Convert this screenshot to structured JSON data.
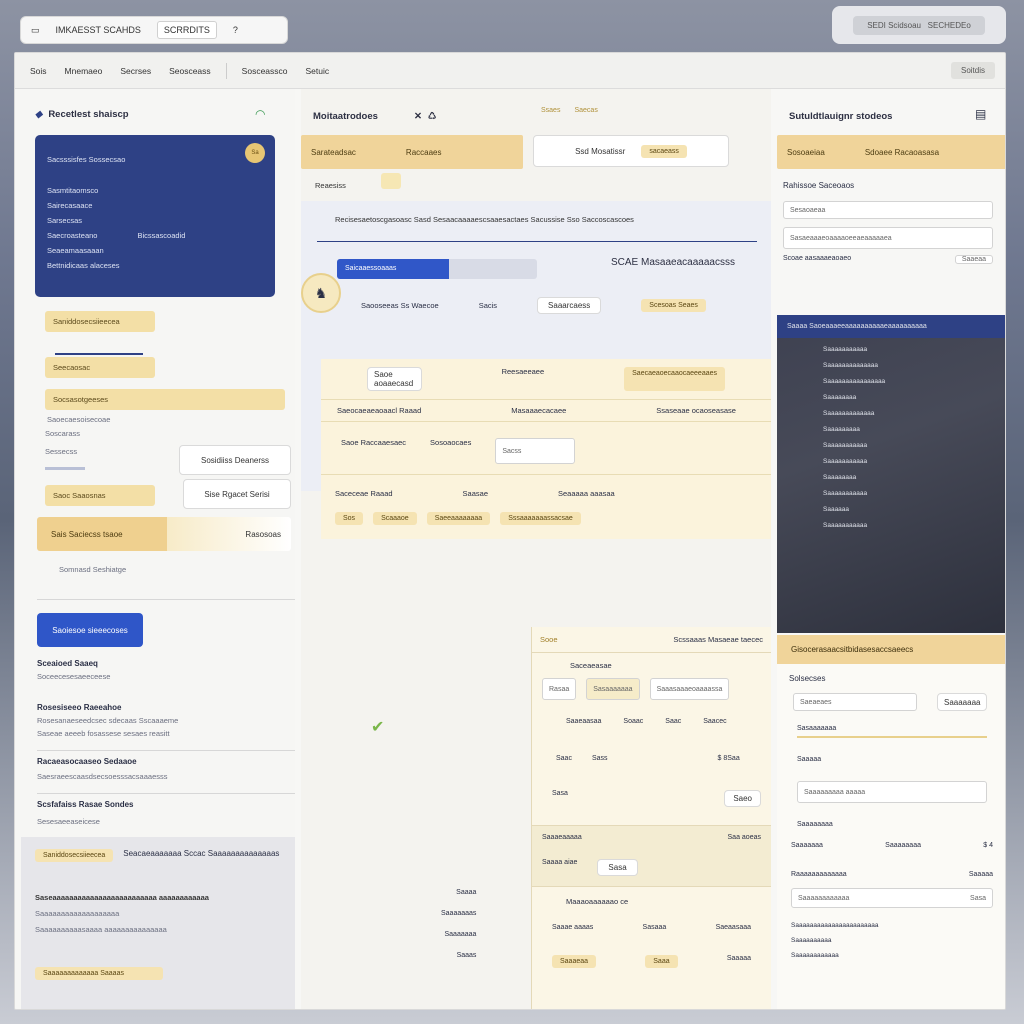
{
  "top_tabs": {
    "tab1": "IMKAESST SCAHDS",
    "tab2": "SCRRDITS",
    "help": "?"
  },
  "top_right": {
    "label": "SEDI Scidsoau",
    "button": "SECHEDEo"
  },
  "menubar": {
    "items": [
      "Sois",
      "Mnemaeo",
      "Secrses",
      "Seosceass",
      "Sosceassco",
      "Setuic"
    ],
    "right_button": "Soitdis"
  },
  "left": {
    "title": "Recetlest shaiscp",
    "card": {
      "header": "Sacsssisfes Sossecsao",
      "rows": [
        "Sasmtitaomsco",
        "Sairecasaace",
        "Sarsecsas",
        "Saecroasteano",
        "Bicssascoadid",
        "Seaeamaasaaan",
        "Bettnidicaas alaceses"
      ],
      "coin": "Sa"
    },
    "gold_rows": [
      "Saniddosecsiieecea",
      "Seecaosac",
      "Socsasotgeeses",
      "Saoc Saaosnas"
    ],
    "labels": [
      "Saoecaesoisecoae",
      "Soscarass",
      "Sessecss"
    ],
    "btn_a": "Sosidiiss Deanerss",
    "btn_b": "Sise Rgacet Serisi",
    "summary_label": "Sais Saciecss tsaoe",
    "summary_value": "Rasosoas",
    "summary_sub": "Somnasd Seshiatge",
    "blue_button": "Saoiesoe sieeecoses",
    "sections": [
      {
        "title": "Sceaioed Saaeq",
        "lines": [
          "Soceecesesaeeceese"
        ]
      },
      {
        "title": "Rosesiseeo Raeeahoe",
        "lines": [
          "Rosesanaeseedcsec sdecaas Sscaaaeme",
          "Saseae aeeeb fosassese sesaes reasitt"
        ]
      },
      {
        "title": "Racaeasocaaseo Sedaaoe",
        "lines": [
          "Saesraeescaasdsecsoesssacsaaaesss"
        ]
      },
      {
        "title": "Scsfafaiss Rasae Sondes",
        "lines": [
          "Sesesaeeaseicese"
        ]
      }
    ]
  },
  "mid": {
    "title": "Moitaatrodoes",
    "top_cards": {
      "gold_a": "Sarateadsac",
      "gold_b": "Raccaaes",
      "gold_c": "Ssaes",
      "white_a": "Ssd Mosatissr",
      "white_b": "sacaeass",
      "white_c": "Saecas"
    },
    "subtitle": "Reaesiss",
    "banner": "Recisesaetoscgasoasc Sasd Sesaacaaaaescsaaesactaes Sacussise Sso Saccoscascoes",
    "progress": {
      "label": "Saicaaessoaaas",
      "value": 0.56,
      "heading": "SCAE Masaaeacaaaaacsss"
    },
    "row1": {
      "a": "Saooseeas Ss Waecoe",
      "b": "Sacis",
      "c": "Saaarcaess",
      "d": "Scesoas Seaes"
    },
    "row2": {
      "a": "Saoe aoaaecasd",
      "b": "Reesaeeaee",
      "c": "Saecaeaoecaaocaeeeaaes"
    },
    "table_head": {
      "a": "Saeocaeaeaoaacl Raaad",
      "b": "Masaaaecacaee",
      "c": "Ssaseaae ocaoseasase"
    },
    "block1": {
      "a": "Saoe Raccaaesaec",
      "b": "Sosoaocaes",
      "c": "Sacss"
    },
    "block2": {
      "a": "Saceceae Raaad",
      "b": "Saasae",
      "c": "Seaaaaa aaasaa"
    },
    "chips": [
      "Sos",
      "Scaaaoe",
      "Saeeaaaaaaaa",
      "Sssaaaaaaassacsae"
    ],
    "lower": {
      "header_a": "Sooe",
      "header_b": "Scssaaas Masaeae taecec",
      "sub": "Saceaeasae",
      "fields": [
        "Rasaa",
        "Sasaaaaaaa",
        "Saaasaaaeoaaaassa"
      ],
      "row_vals": [
        "Saaeaasaa",
        "Soaac",
        "Saac",
        "Saacec"
      ],
      "pair": [
        "Saac",
        "Sass",
        "Sasa"
      ],
      "amount": "$ 8Saa",
      "checkout": {
        "label": "Saaaeaaaaa",
        "value": "Saeo"
      },
      "order": {
        "title": "Saaaa aiae",
        "price": "Sasa",
        "qty": "Saa aoeas"
      },
      "payment": "Maaaoaaaaaao ce",
      "totals": [
        "Saaae aaaas",
        "Sasaaa",
        "Saeaasaaa"
      ],
      "final": [
        "Saaaeaa",
        "Saaa",
        "Saaaaa"
      ]
    },
    "bottom_band": {
      "title": "Seacaeaaaaaaa Sccac Saaaaaaaaaaaaaas",
      "lines": [
        "Saseaaaaaaaaaaaaaaaaaaaaaaaaa aaaaaaaaaaaa",
        "Saaaaaaaaaaaaaaaaaaa",
        "Saaaaaaaaaasaaaa aaaaaaaaaaaaaaa"
      ],
      "gold": "Saaaaaaaaaaaaa Saaaas",
      "right": [
        "Saaaa",
        "Saaaaaaas",
        "Saaaaaaa",
        "Saaas"
      ]
    }
  },
  "right": {
    "title": "Sutuldtlauignr stodeos",
    "gold_a": "Sosoaeiaa",
    "gold_b": "Sdoaee Racaoasasa",
    "section": "Rahissoe Saceoaos",
    "inputs": [
      "Sesaoaeaa",
      "Sasaeaaaeoaaaaoeeaeaaaaaea",
      "Scoae aasaaaeaoaeo"
    ],
    "input_values": [
      "Sasa",
      "Saaeaa"
    ],
    "dark_title": "Saaaa Saoeaaaeeaaaaaaaaaaeaaaaaaaaaa",
    "dark_rows": [
      "Saaaaaaaaaaa",
      "Saaaaaaaaaaaaaa",
      "Saaaaaaaaaaaaaaaa",
      "Saaaaaaaa",
      "Saaaaaaaaaaaaa",
      "Saaaaaaaaa",
      "Saaaaaaaaaaa",
      "Saaaaaaaaaaa",
      "Saaaaaaaa",
      "Saaaaaaaaaaa",
      "Saaaaaa",
      "Saaaaaaaaaaa"
    ],
    "lower_title": "Gisocerasaacsitbidasesaccsaeecs",
    "lower_sub": "Solsecses",
    "lower_input": "Saeaeaes",
    "lower_button": "Saaaaaaa",
    "lower_rows": [
      "Sasaaaaaaa",
      "Saaaaa",
      "Saaaaaaaaa aaaaa",
      "Saaaaaaaa"
    ],
    "summary": {
      "a": "Saaaaaaa",
      "b": "Saaaaaaaa",
      "v": "$ 4",
      "c": "Raaaaaaaaaaaaa",
      "d": "Saaaaa",
      "e": "Saaaaaaaaaaaa"
    },
    "footer": [
      "Saaaaaaaaaaaaaaaaaaaaaaa",
      "Saaaaaaaaaa",
      "Saaaaaaaaaaaa"
    ]
  },
  "colors": {
    "accent_blue": "#2f56c8",
    "navy": "#2e4185",
    "gold": "#f0d49a",
    "cream": "#fbf3dc"
  }
}
